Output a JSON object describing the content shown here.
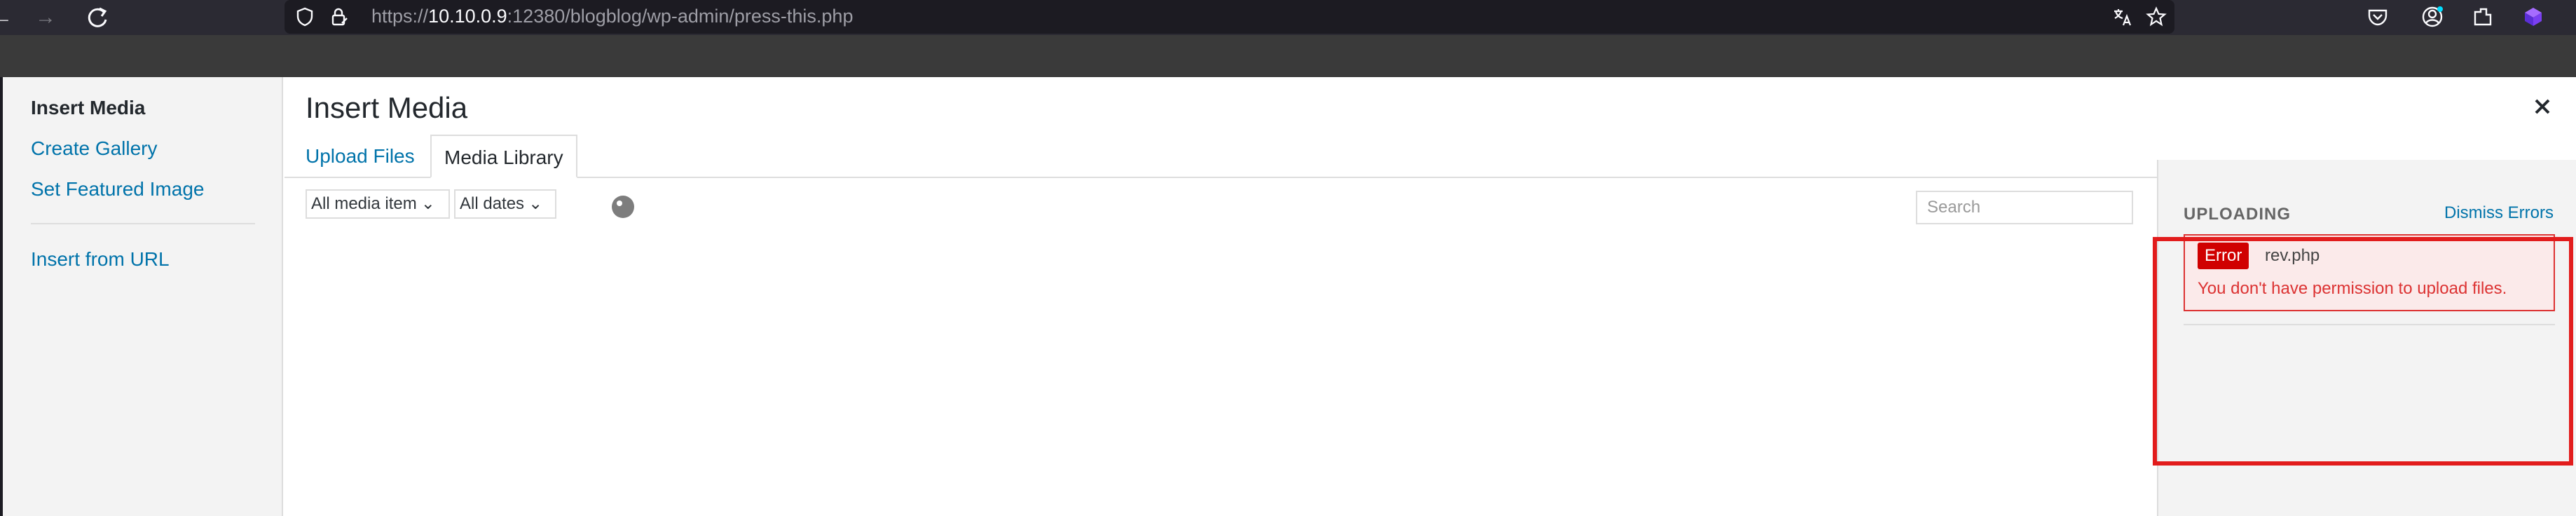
{
  "browser": {
    "url_prefix": "https://",
    "url_host": "10.10.0.9",
    "url_suffix": ":12380/blogblog/wp-admin/press-this.php"
  },
  "media_modal": {
    "menu": {
      "insert_media": "Insert Media",
      "create_gallery": "Create Gallery",
      "set_featured_image": "Set Featured Image",
      "insert_from_url": "Insert from URL"
    },
    "title": "Insert Media",
    "close_symbol": "×",
    "tabs": {
      "upload_files": "Upload Files",
      "media_library": "Media Library"
    },
    "filters": {
      "media_type": "All media item",
      "dates": "All dates"
    },
    "search": {
      "placeholder": "Search",
      "value": ""
    },
    "sidebar": {
      "heading": "UPLOADING",
      "dismiss": "Dismiss Errors",
      "error": {
        "badge": "Error",
        "filename": "rev.php",
        "message": "You don't have permission to upload files."
      }
    }
  },
  "colors": {
    "link": "#0073aa",
    "error_red": "#dc3232",
    "badge_red": "#d00000",
    "highlight_red": "#e21c1c"
  }
}
